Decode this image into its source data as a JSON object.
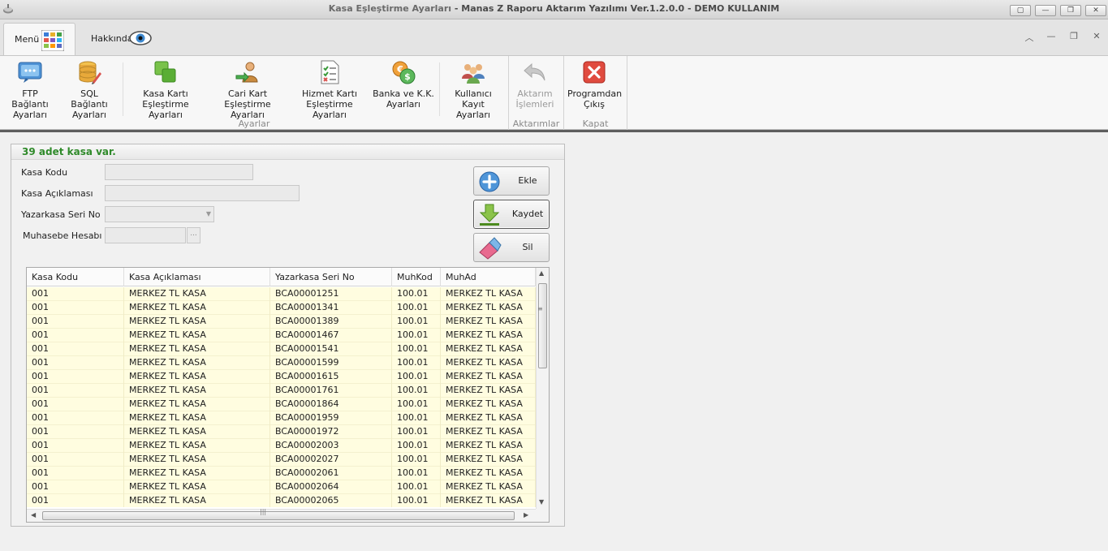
{
  "window": {
    "title_form": "Kasa Eşleştirme Ayarları",
    "title_app": " - Manas Z Raporu Aktarım Yazılımı Ver.1.2.0.0 - DEMO KULLANIM",
    "controls": [
      "restore-window",
      "minimize",
      "maximize",
      "close"
    ]
  },
  "tabs": [
    {
      "label": "Menü",
      "icon": "grid-colors-icon",
      "active": true
    },
    {
      "label": "Hakkında",
      "icon": "eye-icon",
      "active": false
    }
  ],
  "ribbon": {
    "buttons": [
      {
        "label1": "FTP Bağlantı",
        "label2": "Ayarları",
        "icon": "ftp-monitor-icon"
      },
      {
        "label1": "SQL Bağlantı",
        "label2": "Ayarları",
        "icon": "database-pencil-icon"
      },
      {
        "label1": "Kasa Kartı",
        "label2": "Eşleştirme Ayarları",
        "icon": "green-cards-icon"
      },
      {
        "label1": "Cari Kart",
        "label2": "Eşleştirme Ayarları",
        "icon": "person-arrow-icon"
      },
      {
        "label1": "Hizmet Kartı",
        "label2": "Eşleştirme Ayarları",
        "icon": "checklist-icon"
      },
      {
        "label1": "Banka ve K.K.",
        "label2": "Ayarları",
        "icon": "currency-coins-icon"
      },
      {
        "label1": "Kullanıcı",
        "label2": "Kayıt Ayarları",
        "icon": "users-icon"
      },
      {
        "label1": "Aktarım",
        "label2": "İşlemleri",
        "icon": "undo-arrow-icon",
        "disabled": true
      },
      {
        "label1": "Programdan",
        "label2": "Çıkış",
        "icon": "red-x-icon"
      }
    ],
    "groups": [
      "Ayarlar",
      "Aktarımlar",
      "Kapat"
    ]
  },
  "panel": {
    "header": "39 adet kasa var.",
    "fields": {
      "kasa_kodu": {
        "label": "Kasa Kodu",
        "value": ""
      },
      "kasa_aciklamasi": {
        "label": "Kasa Açıklaması",
        "value": ""
      },
      "yazarkasa_seri_no": {
        "label": "Yazarkasa Seri No",
        "value": ""
      },
      "muhasebe_hesabi": {
        "label": "Muhasebe Hesabı",
        "value": "",
        "button": "..."
      }
    },
    "actions": {
      "add": "Ekle",
      "save": "Kaydet",
      "delete": "Sil"
    }
  },
  "grid": {
    "columns": [
      "Kasa Kodu",
      "Kasa Açıklaması",
      "Yazarkasa Seri No",
      "MuhKod",
      "MuhAd"
    ],
    "rows": [
      [
        "001",
        "MERKEZ TL KASA",
        "BCA00001251",
        "100.01",
        "MERKEZ TL KASA"
      ],
      [
        "001",
        "MERKEZ TL KASA",
        "BCA00001341",
        "100.01",
        "MERKEZ TL KASA"
      ],
      [
        "001",
        "MERKEZ TL KASA",
        "BCA00001389",
        "100.01",
        "MERKEZ TL KASA"
      ],
      [
        "001",
        "MERKEZ TL KASA",
        "BCA00001467",
        "100.01",
        "MERKEZ TL KASA"
      ],
      [
        "001",
        "MERKEZ TL KASA",
        "BCA00001541",
        "100.01",
        "MERKEZ TL KASA"
      ],
      [
        "001",
        "MERKEZ TL KASA",
        "BCA00001599",
        "100.01",
        "MERKEZ TL KASA"
      ],
      [
        "001",
        "MERKEZ TL KASA",
        "BCA00001615",
        "100.01",
        "MERKEZ TL KASA"
      ],
      [
        "001",
        "MERKEZ TL KASA",
        "BCA00001761",
        "100.01",
        "MERKEZ TL KASA"
      ],
      [
        "001",
        "MERKEZ TL KASA",
        "BCA00001864",
        "100.01",
        "MERKEZ TL KASA"
      ],
      [
        "001",
        "MERKEZ TL KASA",
        "BCA00001959",
        "100.01",
        "MERKEZ TL KASA"
      ],
      [
        "001",
        "MERKEZ TL KASA",
        "BCA00001972",
        "100.01",
        "MERKEZ TL KASA"
      ],
      [
        "001",
        "MERKEZ TL KASA",
        "BCA00002003",
        "100.01",
        "MERKEZ TL KASA"
      ],
      [
        "001",
        "MERKEZ TL KASA",
        "BCA00002027",
        "100.01",
        "MERKEZ TL KASA"
      ],
      [
        "001",
        "MERKEZ TL KASA",
        "BCA00002061",
        "100.01",
        "MERKEZ TL KASA"
      ],
      [
        "001",
        "MERKEZ TL KASA",
        "BCA00002064",
        "100.01",
        "MERKEZ TL KASA"
      ],
      [
        "001",
        "MERKEZ TL KASA",
        "BCA00002065",
        "100.01",
        "MERKEZ TL KASA"
      ]
    ]
  }
}
